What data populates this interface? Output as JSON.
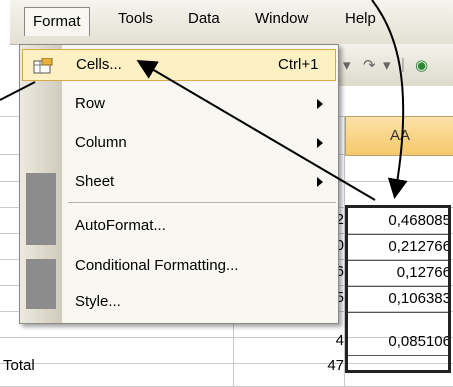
{
  "menubar": {
    "items": [
      {
        "label": "Format",
        "active": true
      },
      {
        "label": "Tools"
      },
      {
        "label": "Data"
      },
      {
        "label": "Window"
      },
      {
        "label": "Help"
      }
    ]
  },
  "format_menu": {
    "items": [
      {
        "label": "Cells...",
        "shortcut": "Ctrl+1"
      },
      {
        "label": "Row"
      },
      {
        "label": "Column"
      },
      {
        "label": "Sheet"
      },
      {
        "label": "AutoFormat..."
      },
      {
        "label": "Conditional Formatting..."
      },
      {
        "label": "Style..."
      }
    ]
  },
  "sheet": {
    "column_header": "AA",
    "partial_counts": [
      "2",
      "0",
      "6",
      "5"
    ],
    "last_count": "4",
    "values": [
      "0,468085",
      "0,212766",
      "0,12766",
      "0,106383",
      "0,085106"
    ],
    "total_label": "Total",
    "total_value": "47"
  },
  "colors": {
    "menu_highlight": "#fdf1c4",
    "column_header": "#f6c86b"
  }
}
